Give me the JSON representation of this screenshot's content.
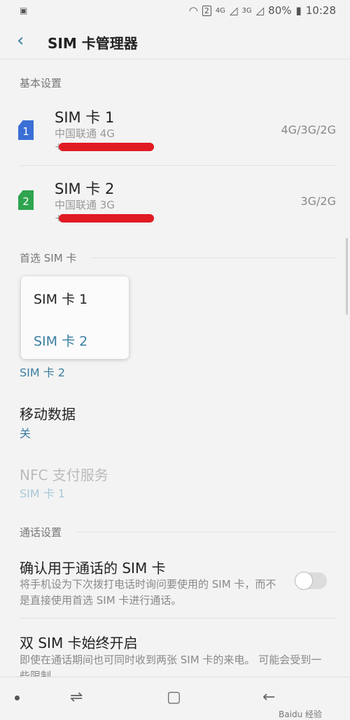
{
  "status_bar": {
    "icons_left": [
      "image-icon"
    ],
    "net_4g": "4G",
    "net_3g": "3G",
    "sim_num": "2",
    "battery": "80%",
    "time": "10:28"
  },
  "app_bar": {
    "back_icon": "‹",
    "title": "SIM 卡管理器"
  },
  "basic_settings": {
    "header": "基本设置",
    "sims": [
      {
        "name": "SIM 卡 1",
        "carrier": "中国联通 4G",
        "number_prefix": "+",
        "network": "4G/3G/2G",
        "icon_label": "1",
        "icon_color": "#3b6fd6"
      },
      {
        "name": "SIM 卡 2",
        "carrier": "中国联通 3G",
        "number_prefix": "+",
        "network": "3G/2G",
        "icon_label": "2",
        "icon_color": "#2ea44f"
      }
    ]
  },
  "preferred_sim": {
    "header": "首选 SIM 卡",
    "options": [
      "SIM 卡 1",
      "SIM 卡 2"
    ],
    "selected": "SIM 卡 2",
    "below_value": "SIM 卡 2"
  },
  "mobile_data": {
    "title": "移动数据",
    "value": "关"
  },
  "nfc": {
    "title": "NFC 支付服务",
    "value": "SIM 卡 1"
  },
  "call_settings": {
    "header": "通话设置",
    "confirm_sim": {
      "title": "确认用于通话的 SIM 卡",
      "desc": "将手机设为下次拨打电话时询问要使用的 SIM 卡，而不是直接使用首选 SIM 卡进行通话。",
      "enabled": false
    },
    "dual_sim_always_on": {
      "title": "双 SIM 卡始终开启",
      "desc": "即使在通话期间也可同时收到两张 SIM 卡的来电。 可能会受到一些限制"
    }
  },
  "nav_bar": {
    "recents": "⇌",
    "home": "▢",
    "back": "←"
  },
  "watermark": "Baidu 经验"
}
